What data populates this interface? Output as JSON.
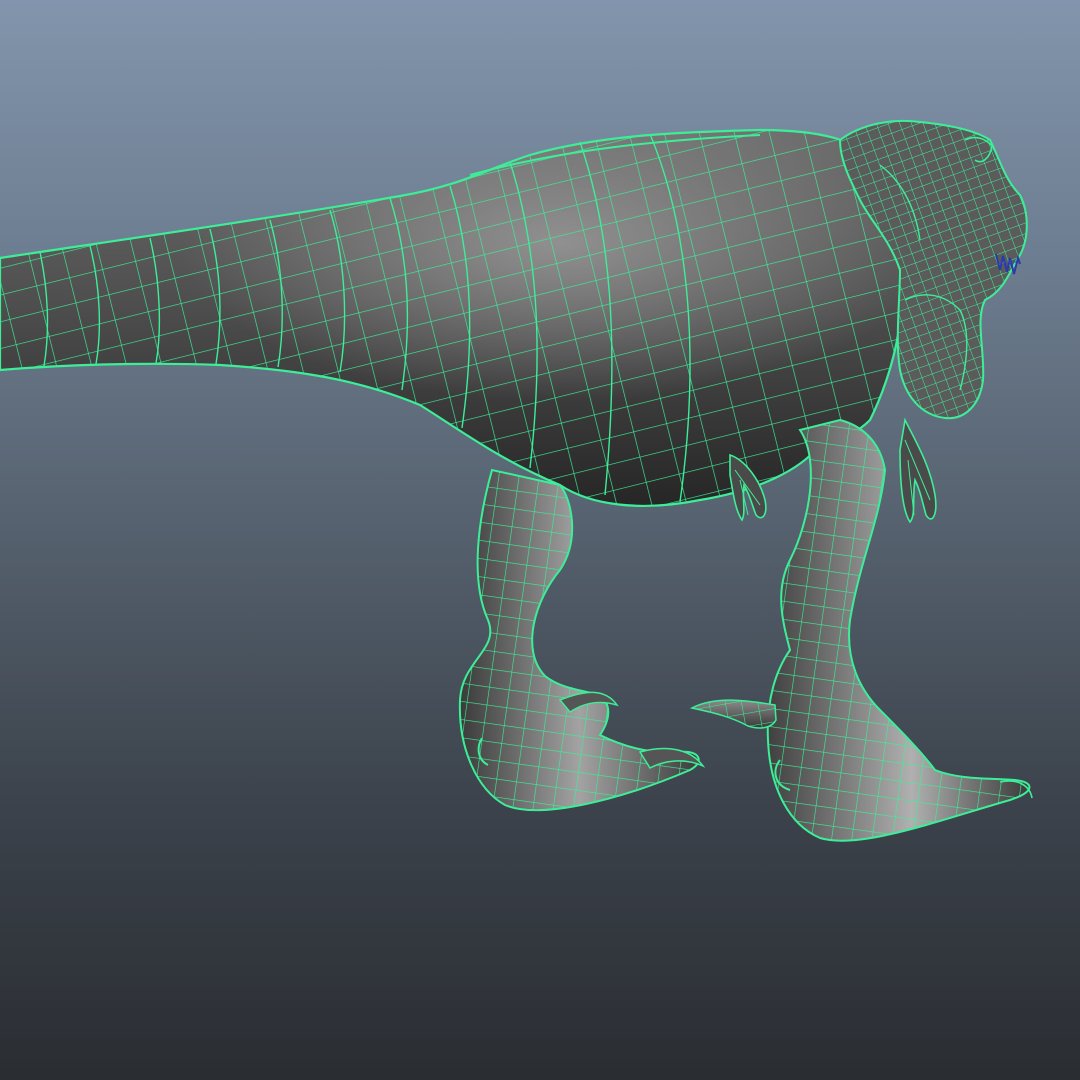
{
  "viewport": {
    "background_top": "#8295ac",
    "background_bottom": "#2a2d32"
  },
  "model": {
    "subject": "t-rex-wireframe",
    "wireframe_color": "#3dee98",
    "surface_color": "#555555",
    "teeth_color": "#2b3aa8"
  }
}
